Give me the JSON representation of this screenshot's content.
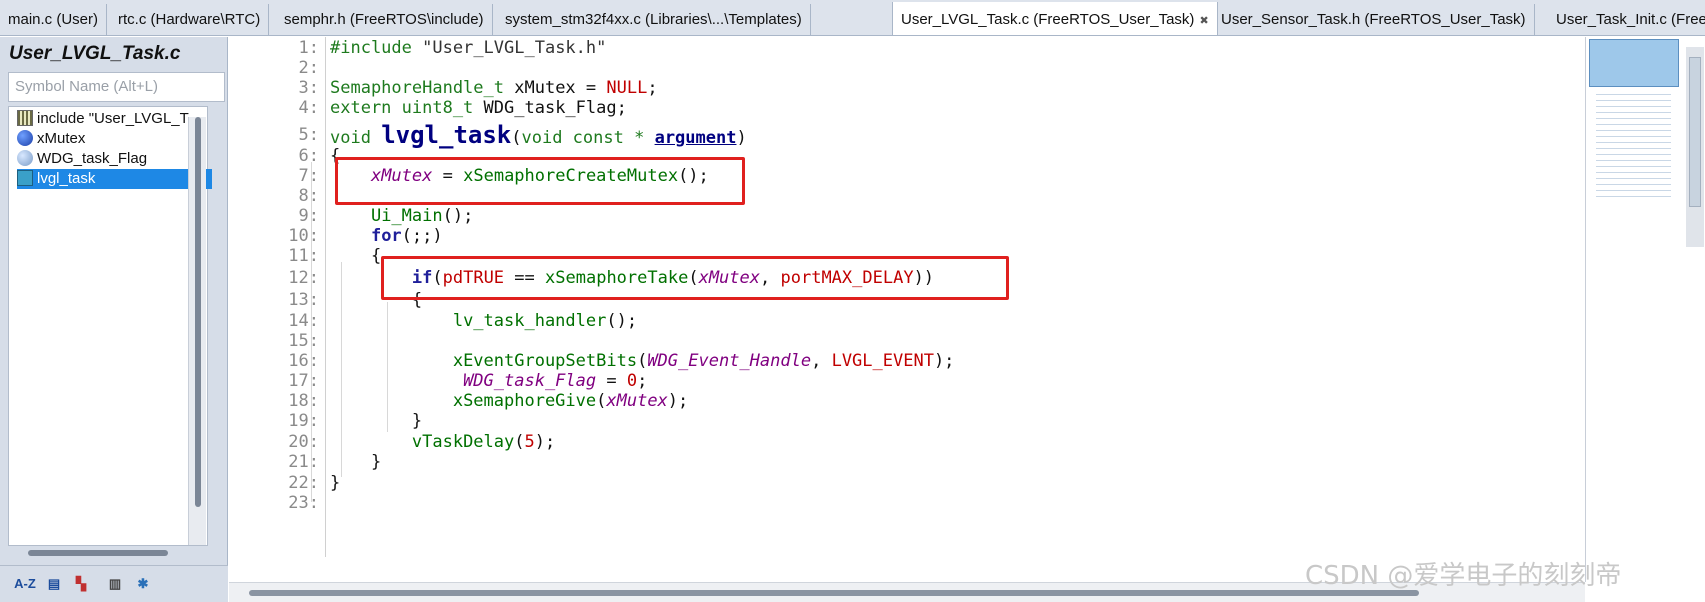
{
  "tabs": [
    {
      "label": "main.c (User)",
      "active": false
    },
    {
      "label": "rtc.c (Hardware\\RTC)",
      "active": false
    },
    {
      "label": "semphr.h (FreeRTOS\\include)",
      "active": false
    },
    {
      "label": "system_stm32f4xx.c (Libraries\\...\\Templates)",
      "active": false
    },
    {
      "label": "User_LVGL_Task.c (FreeRTOS_User_Task)",
      "active": true
    },
    {
      "label": "User_Sensor_Task.h (FreeRTOS_User_Task)",
      "active": false
    },
    {
      "label": "User_Task_Init.c (FreeRTOS",
      "active": false
    }
  ],
  "sidebar": {
    "title": "User_LVGL_Task.c",
    "search_placeholder": "Symbol Name (Alt+L)",
    "symbols": [
      {
        "label": "include \"User_LVGL_T",
        "icon": "include-icon"
      },
      {
        "label": "xMutex",
        "icon": "variable-icon"
      },
      {
        "label": "WDG_task_Flag",
        "icon": "extern-variable-icon"
      },
      {
        "label": "lvgl_task",
        "icon": "function-icon",
        "selected": true
      }
    ],
    "toolbar": [
      "sort-az-icon",
      "list-icon",
      "color-icon",
      "book-icon",
      "gear-icon"
    ],
    "toolbar_az_label": "A-Z"
  },
  "editor": {
    "lines": [
      {
        "n": "1:",
        "code": "#include \"User_LVGL_Task.h\""
      },
      {
        "n": "2:",
        "code": ""
      },
      {
        "n": "3:",
        "code": "SemaphoreHandle_t xMutex = NULL;"
      },
      {
        "n": "4:",
        "code": "extern uint8_t WDG_task_Flag;"
      },
      {
        "n": "5:",
        "code": "void lvgl_task(void const * argument)"
      },
      {
        "n": "6:",
        "code": "{"
      },
      {
        "n": "7:",
        "code": "    xMutex = xSemaphoreCreateMutex();"
      },
      {
        "n": "8:",
        "code": ""
      },
      {
        "n": "9:",
        "code": "    Ui_Main();"
      },
      {
        "n": "10:",
        "code": "    for(;;)"
      },
      {
        "n": "11:",
        "code": "    {"
      },
      {
        "n": "12:",
        "code": "        if(pdTRUE == xSemaphoreTake(xMutex, portMAX_DELAY))"
      },
      {
        "n": "13:",
        "code": "        {"
      },
      {
        "n": "14:",
        "code": "            lv_task_handler();"
      },
      {
        "n": "15:",
        "code": ""
      },
      {
        "n": "16:",
        "code": "            xEventGroupSetBits(WDG_Event_Handle, LVGL_EVENT);"
      },
      {
        "n": "17:",
        "code": "             WDG_task_Flag = 0;"
      },
      {
        "n": "18:",
        "code": "            xSemaphoreGive(xMutex);"
      },
      {
        "n": "19:",
        "code": "        }"
      },
      {
        "n": "20:",
        "code": "        vTaskDelay(5);"
      },
      {
        "n": "21:",
        "code": "    }"
      },
      {
        "n": "22:",
        "code": "}"
      },
      {
        "n": "23:",
        "code": ""
      }
    ]
  },
  "watermark": "CSDN @爱学电子的刻刻帝",
  "colors": {
    "highlight_box": "#e0201e",
    "selection": "#1e88e5"
  }
}
